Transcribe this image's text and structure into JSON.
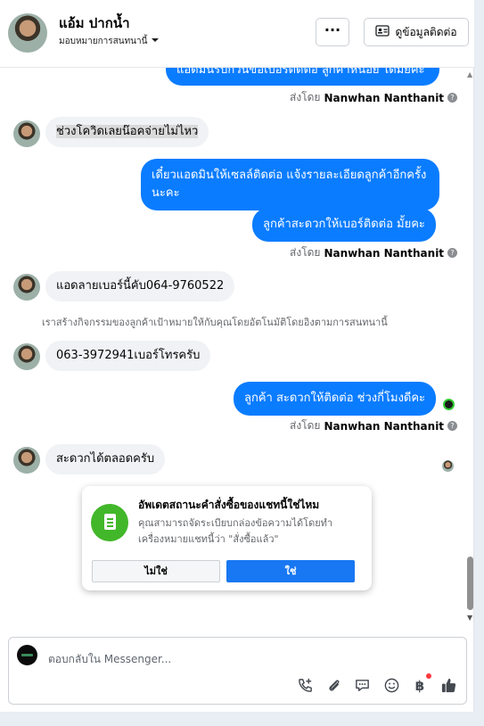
{
  "header": {
    "name": "แอ้ม ปากน้ำ",
    "assign_label": "มอบหมายการสนทนานี้",
    "more_label": "···",
    "contact_button": "ดูข้อมูลติดต่อ"
  },
  "messages": {
    "m0": "แอดมินรบกวนขอเบอร์ติดต่อ ลูกค้าหน่อย ได้มั้ยคะ",
    "sentby_prefix": "ส่งโดย",
    "sentby_name": "Nanwhan Nanthanit",
    "m1": "ช่วงโควิดเลยน๊อคจ่ายไม่ไหว",
    "m2": "เดี๋ยวแอดมินให้เซลล์ติดต่อ แจ้งรายละเอียดลูกค้าอีกครั้งนะคะ",
    "m3": "ลูกค้าสะดวกให้เบอร์ติดต่อ มั้ยคะ",
    "m4": "แอดลายเบอร์นี้คับ064-9760522",
    "system": "เราสร้างกิจกรรมของลูกค้าเป้าหมายให้กับคุณโดยอัตโนมัติโดยอิงตามการสนทนานี้",
    "m5": "063-3972941เบอร์โทรครับ",
    "m6": "ลูกค้า สะดวกให้ติดต่อ ช่วงกี่โมงดีคะ",
    "m7": "สะดวกได้ตลอดครับ"
  },
  "card": {
    "title": "อัพเดตสถานะคำสั่งซื้อของแชทนี้ใช่ไหม",
    "text": "คุณสามารถจัดระเบียบกล่องข้อความได้โดยทำเครื่องหมายแชทนี้ว่า \"สั่งซื้อแล้ว\"",
    "no": "ไม่ใช่",
    "yes": "ใช่"
  },
  "composer": {
    "placeholder": "ตอบกลับใน Messenger..."
  },
  "icons": {
    "call": "phone-plus-icon",
    "attach": "paperclip-icon",
    "saved_replies": "chat-bubbles-icon",
    "emoji": "emoji-icon",
    "payment": "baht-icon",
    "like": "thumbs-up-icon"
  },
  "colors": {
    "outgoing_bubble": "#0a7cff",
    "incoming_bubble": "#f0f2f5",
    "primary_button": "#1877f2",
    "card_icon": "#42b72a"
  }
}
